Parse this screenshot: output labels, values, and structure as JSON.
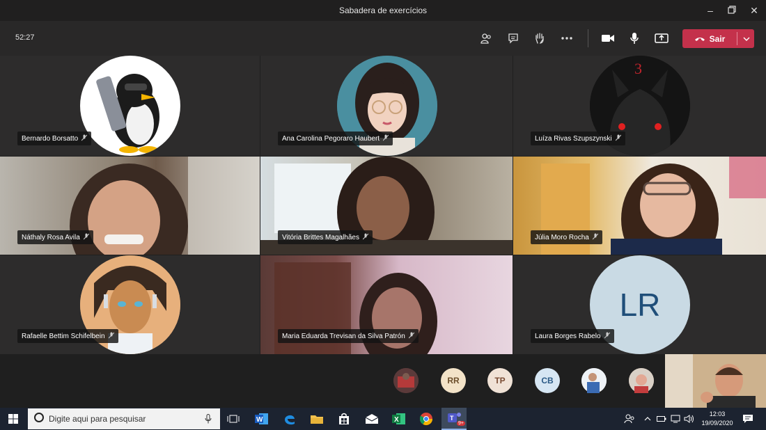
{
  "window": {
    "title": "Sabadera de exercícios"
  },
  "toolbar": {
    "timer": "52:27",
    "leave_label": "Sair"
  },
  "participants": [
    {
      "name": "Bernardo Borsatto"
    },
    {
      "name": "Ana Carolina Pegoraro Haubert"
    },
    {
      "name": "Luíza Rivas Szupszynski"
    },
    {
      "name": "Náthaly Rosa Avila"
    },
    {
      "name": "Vitória Brittes Magalhães"
    },
    {
      "name": "Júlia Moro Rocha"
    },
    {
      "name": "Rafaelle Bettim Schifelbein"
    },
    {
      "name": "Maria Eduarda Trevisan da Silva Patrón"
    },
    {
      "name": "Laura Borges Rabelo",
      "initials": "LR"
    }
  ],
  "overflow_participants": [
    {
      "initials": ""
    },
    {
      "initials": "RR"
    },
    {
      "initials": "TP"
    },
    {
      "initials": "CB"
    },
    {
      "initials": ""
    },
    {
      "initials": ""
    }
  ],
  "taskbar": {
    "search_placeholder": "Digite aqui para pesquisar",
    "time": "12:03",
    "date": "19/09/2020",
    "teams_badge": "9+"
  },
  "colors": {
    "leave": "#c4314b",
    "titlebar": "#201f1f",
    "toolbar": "#292828",
    "tile": "#2d2c2c"
  }
}
